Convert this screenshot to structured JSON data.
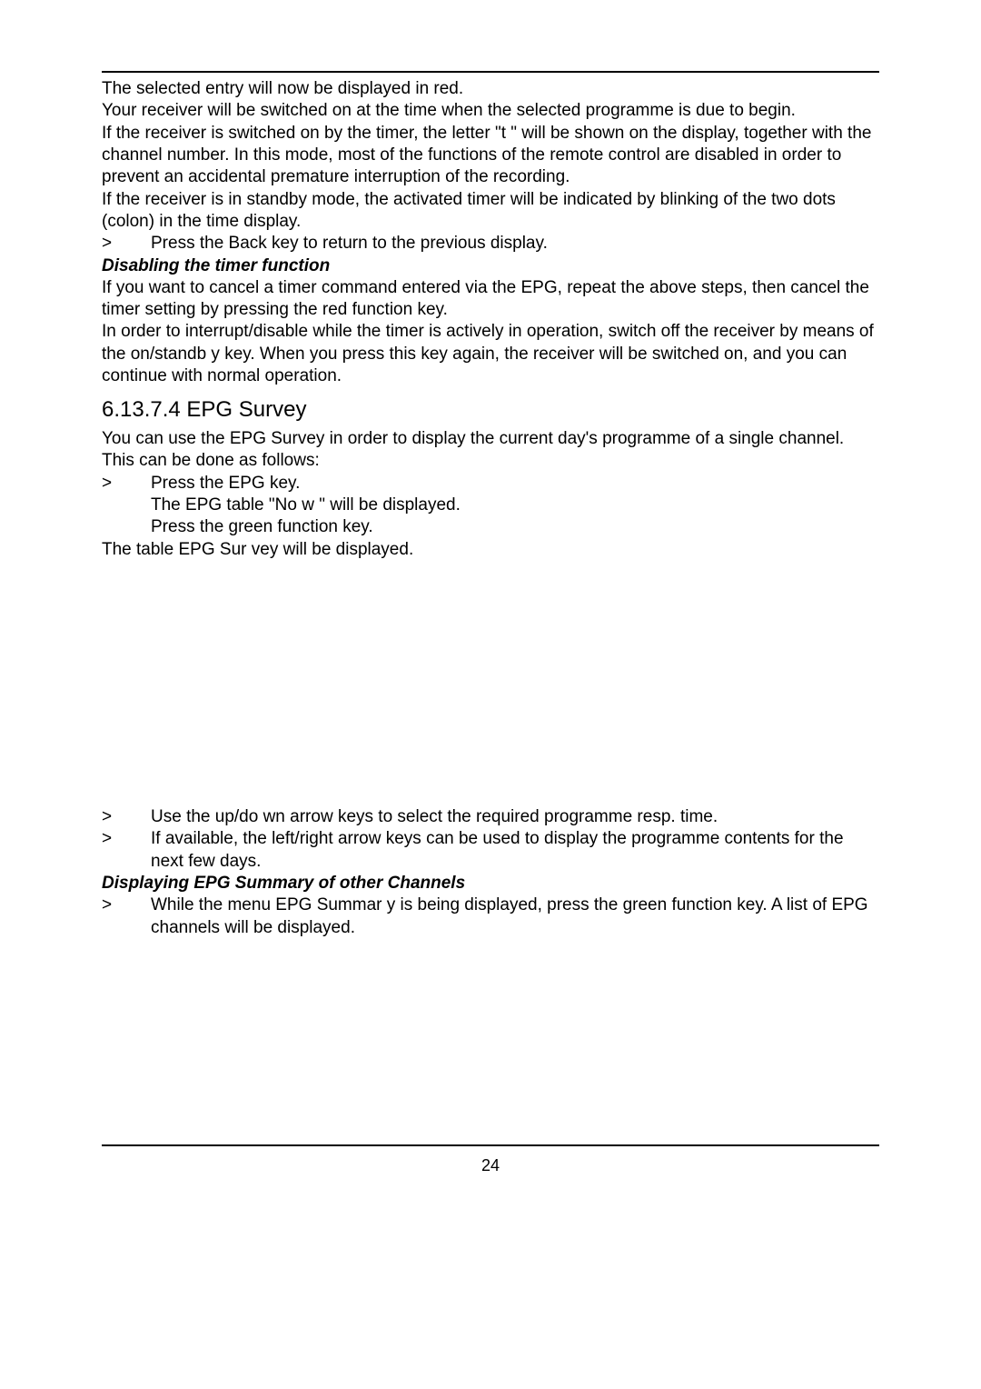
{
  "p1": "The selected entry will now be displayed in red.",
  "p2": "Your receiver will be switched on at the time when the selected programme is due to begin.",
  "p3": "If the receiver is switched on by the timer, the letter \"t \" will be shown on the display, together with the channel number. In this mode, most of the functions of the remote control are disabled in order to prevent an accidental premature interruption of the recording.",
  "p4": "If the receiver is in standby mode, the activated timer will be indicated by blinking of the two dots (colon) in the time display.",
  "step_back": "Press the Back key to return to the previous display.",
  "h_disable": "Disabling the timer function",
  "p5": "If you want to cancel a timer command entered via the EPG, repeat the above steps, then cancel the timer setting by pressing the red function    key.",
  "p6": "In order to interrupt/disable while the timer is actively in operation, switch off the receiver by means of the on/standb   y key. When you press this key again, the receiver will be switched on, and you can continue with normal operation.",
  "h_survey": "6.13.7.4 EPG Survey",
  "p7": "You can use the EPG Survey in order to display the current day's programme of a single channel. This can be done as follows:",
  "step_epg": "Press the EPG  key.",
  "step_now": "The EPG table \"No w \" will be displayed.",
  "step_green": "Press the green  function key.",
  "p8": "The table EPG Sur   vey will be displayed.",
  "step_updown": "Use the up/do wn  arrow keys to select the required programme resp. time.",
  "step_lr": "If available, the left/right    arrow keys can be used to display the programme contents for the next few days.",
  "h_other": "Displaying EPG Summary of other Channels",
  "step_summary": "While the menu EPG Summar   y is being displayed, press the green  function key. A list of EPG channels will be displayed.",
  "gt": ">",
  "page": "24"
}
